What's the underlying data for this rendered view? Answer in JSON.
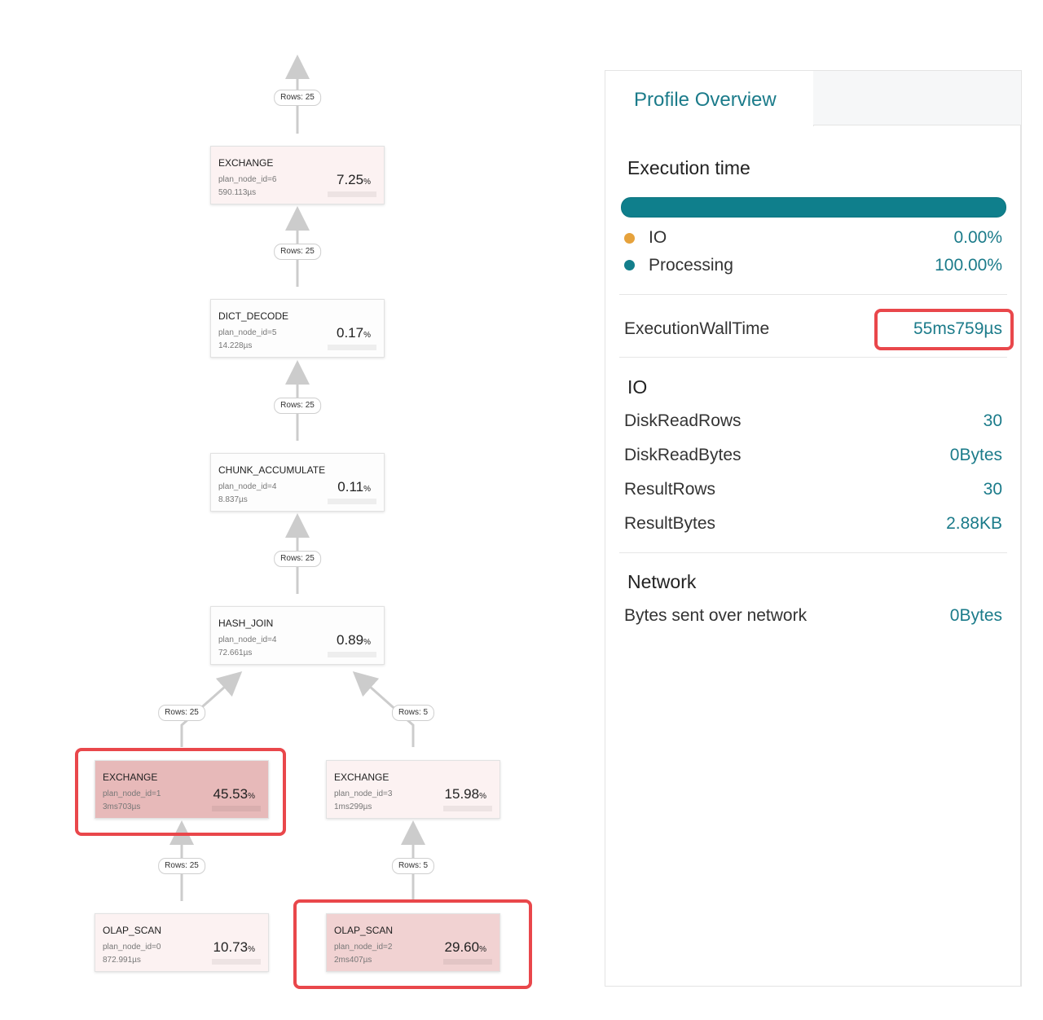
{
  "graph": {
    "nodes": [
      {
        "name": "EXCHANGE",
        "plan": "plan_node_id=6",
        "time": "590.113µs",
        "pct": "7.25",
        "unit": "%",
        "level": "light"
      },
      {
        "name": "DICT_DECODE",
        "plan": "plan_node_id=5",
        "time": "14.228µs",
        "pct": "0.17",
        "unit": "%",
        "level": "white"
      },
      {
        "name": "CHUNK_ACCUMULATE",
        "plan": "plan_node_id=4",
        "time": "8.837µs",
        "pct": "0.11",
        "unit": "%",
        "level": "white"
      },
      {
        "name": "HASH_JOIN",
        "plan": "plan_node_id=4",
        "time": "72.661µs",
        "pct": "0.89",
        "unit": "%",
        "level": "white"
      },
      {
        "name": "EXCHANGE",
        "plan": "plan_node_id=1",
        "time": "3ms703µs",
        "pct": "45.53",
        "unit": "%",
        "level": "dark"
      },
      {
        "name": "EXCHANGE",
        "plan": "plan_node_id=3",
        "time": "1ms299µs",
        "pct": "15.98",
        "unit": "%",
        "level": "light"
      },
      {
        "name": "OLAP_SCAN",
        "plan": "plan_node_id=0",
        "time": "872.991µs",
        "pct": "10.73",
        "unit": "%",
        "level": "light"
      },
      {
        "name": "OLAP_SCAN",
        "plan": "plan_node_id=2",
        "time": "2ms407µs",
        "pct": "29.60",
        "unit": "%",
        "level": "medium"
      }
    ],
    "edge_labels": [
      "Rows: 25",
      "Rows: 25",
      "Rows: 25",
      "Rows: 25",
      "Rows: 25",
      "Rows: 5",
      "Rows: 25",
      "Rows: 5"
    ],
    "colors": {
      "white": "#fdfdfd",
      "light": "#fcf2f2",
      "medium": "#f1d2d2",
      "dark": "#e7b9b9",
      "highlight": "#e9474b",
      "edge": "#cccccc"
    }
  },
  "panel": {
    "tab_active": "Profile Overview",
    "execution_title": "Execution time",
    "execution_bar_color": "#0f7f8c",
    "legend": [
      {
        "label": "IO",
        "value": "0.00%",
        "dot_color": "#e6a23c"
      },
      {
        "label": "Processing",
        "value": "100.00%",
        "dot_color": "#137e8b"
      }
    ],
    "wall_time": {
      "label": "ExecutionWallTime",
      "value": "55ms759µs"
    },
    "io": {
      "title": "IO",
      "rows": [
        {
          "label": "DiskReadRows",
          "value": "30"
        },
        {
          "label": "DiskReadBytes",
          "value": "0Bytes"
        },
        {
          "label": "ResultRows",
          "value": "30"
        },
        {
          "label": "ResultBytes",
          "value": "2.88KB"
        }
      ]
    },
    "network": {
      "title": "Network",
      "rows": [
        {
          "label": "Bytes sent over network",
          "value": "0Bytes"
        }
      ]
    },
    "accent_color": "#1b7b8a"
  }
}
